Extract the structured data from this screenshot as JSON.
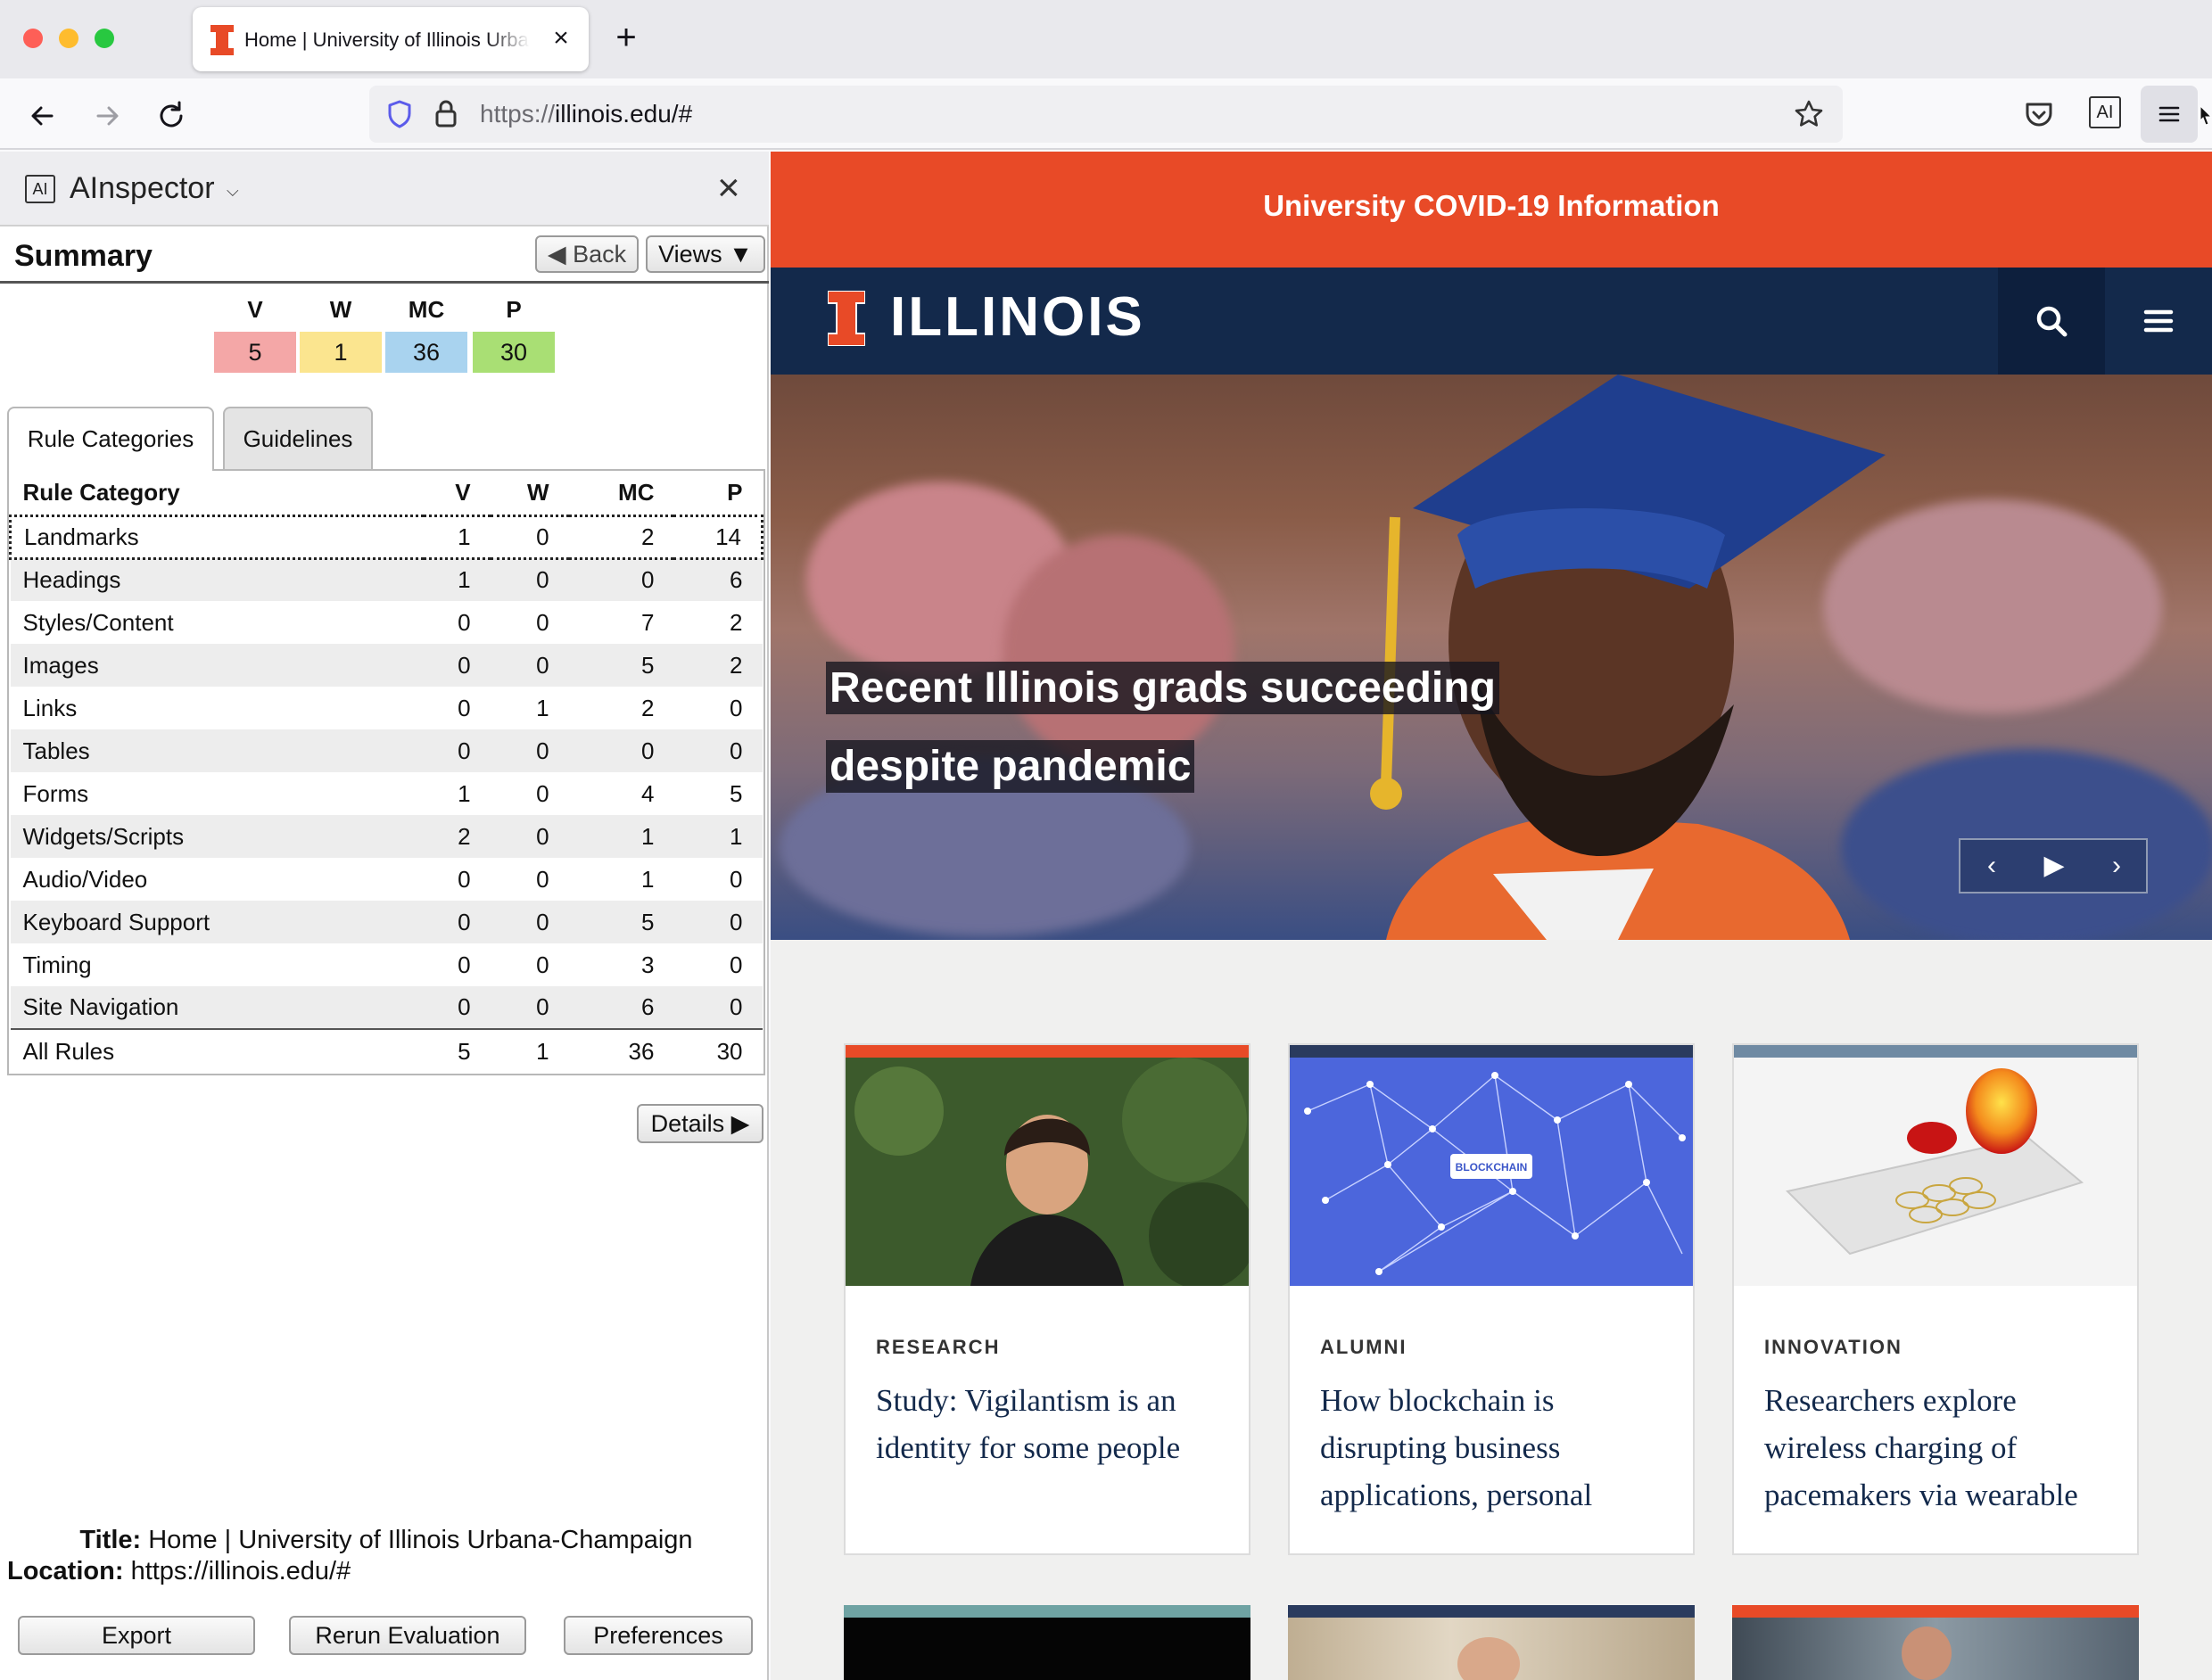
{
  "browser": {
    "tab_title": "Home | University of Illinois Urbana-Champaign",
    "url_prefix": "https://",
    "url_host": "illinois.edu/#",
    "icons": [
      "back-icon",
      "forward-icon",
      "reload-icon",
      "shield-icon",
      "lock-icon",
      "star-icon",
      "pocket-icon",
      "ainspector-icon",
      "hamburger-icon"
    ]
  },
  "panel": {
    "logo": "AI",
    "name": "AInspector",
    "summary_title": "Summary",
    "back_label": "◀ Back",
    "views_label": "Views ▼",
    "summary": [
      {
        "label": "V",
        "value": "5",
        "color": "#f4a7a7"
      },
      {
        "label": "W",
        "value": "1",
        "color": "#fbe58f"
      },
      {
        "label": "MC",
        "value": "36",
        "color": "#a9d3ef"
      },
      {
        "label": "P",
        "value": "30",
        "color": "#a9df74"
      }
    ],
    "tabs": [
      "Rule Categories",
      "Guidelines"
    ],
    "table": {
      "headers": [
        "Rule Category",
        "V",
        "W",
        "MC",
        "P"
      ],
      "rows": [
        [
          "Landmarks",
          "1",
          "0",
          "2",
          "14"
        ],
        [
          "Headings",
          "1",
          "0",
          "0",
          "6"
        ],
        [
          "Styles/Content",
          "0",
          "0",
          "7",
          "2"
        ],
        [
          "Images",
          "0",
          "0",
          "5",
          "2"
        ],
        [
          "Links",
          "0",
          "1",
          "2",
          "0"
        ],
        [
          "Tables",
          "0",
          "0",
          "0",
          "0"
        ],
        [
          "Forms",
          "1",
          "0",
          "4",
          "5"
        ],
        [
          "Widgets/Scripts",
          "2",
          "0",
          "1",
          "1"
        ],
        [
          "Audio/Video",
          "0",
          "0",
          "1",
          "0"
        ],
        [
          "Keyboard Support",
          "0",
          "0",
          "5",
          "0"
        ],
        [
          "Timing",
          "0",
          "0",
          "3",
          "0"
        ],
        [
          "Site Navigation",
          "0",
          "0",
          "6",
          "0"
        ]
      ],
      "total": [
        "All Rules",
        "5",
        "1",
        "36",
        "30"
      ]
    },
    "details_label": "Details ▶",
    "title_label": "Title:",
    "title_value": "Home | University of Illinois Urbana-Champaign",
    "location_label": "Location:",
    "location_value": "https://illinois.edu/#",
    "export_label": "Export",
    "rerun_label": "Rerun Evaluation",
    "preferences_label": "Preferences"
  },
  "site": {
    "covid_link": "University COVID-19 Information",
    "wordmark": "ILLINOIS",
    "brand_orange": "#e84a27",
    "brand_blue": "#13294b",
    "hero_line1": "Recent Illinois grads succeeding",
    "hero_line2": "despite pandemic",
    "cards": [
      {
        "kicker": "RESEARCH",
        "title": "Study: Vigilantism is an identity for some people",
        "accent": "#e84a27"
      },
      {
        "kicker": "ALUMNI",
        "title": "How blockchain is disrupting business applications, personal",
        "accent": "#2a3b5e",
        "image_label": "BLOCKCHAIN"
      },
      {
        "kicker": "INNOVATION",
        "title": "Researchers explore wireless charging of pacemakers via wearable",
        "accent": "#6f8aa3"
      }
    ]
  }
}
